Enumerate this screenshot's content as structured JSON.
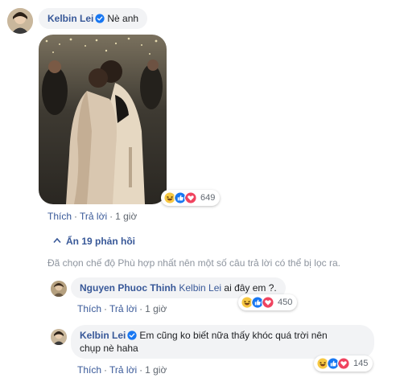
{
  "colors": {
    "link": "#385898",
    "bubble": "#f2f3f5",
    "meta": "#606770",
    "notice": "#8d949e",
    "verified": "#1877f2"
  },
  "comment": {
    "author": "Kelbin Lei",
    "verified_icon": "verified-badge-icon",
    "text": "Nè anh",
    "photo_alt": "photo of two people hugging at a party",
    "actions": {
      "like": "Thích",
      "reply": "Trả lời",
      "time": "1 giờ"
    },
    "reactions": {
      "icons": [
        "haha-icon",
        "like-icon",
        "love-icon"
      ],
      "count": "649"
    }
  },
  "replies_toggle": {
    "icon": "chevron-up-icon",
    "label": "Ẩn 19 phản hồi"
  },
  "filter_notice": "Đã chọn chế độ Phù hợp nhất nên một số câu trả lời có thể bị lọc ra.",
  "replies": [
    {
      "author": "Nguyen Phuoc Thinh",
      "mention": "Kelbin Lei",
      "text": " ai đây em ?.",
      "actions": {
        "like": "Thích",
        "reply": "Trả lời",
        "time": "1 giờ"
      },
      "reactions": {
        "icons": [
          "haha-icon",
          "like-icon",
          "love-icon"
        ],
        "count": "450"
      }
    },
    {
      "author": "Kelbin Lei",
      "verified_icon": "verified-badge-icon",
      "text_line1": "Em cũng ko biết nữa thấy khóc quá trời nên",
      "text_line2": "chụp nè haha",
      "actions": {
        "like": "Thích",
        "reply": "Trả lời",
        "time": "1 giờ"
      },
      "reactions": {
        "icons": [
          "haha-icon",
          "like-icon",
          "love-icon"
        ],
        "count": "145"
      }
    }
  ]
}
